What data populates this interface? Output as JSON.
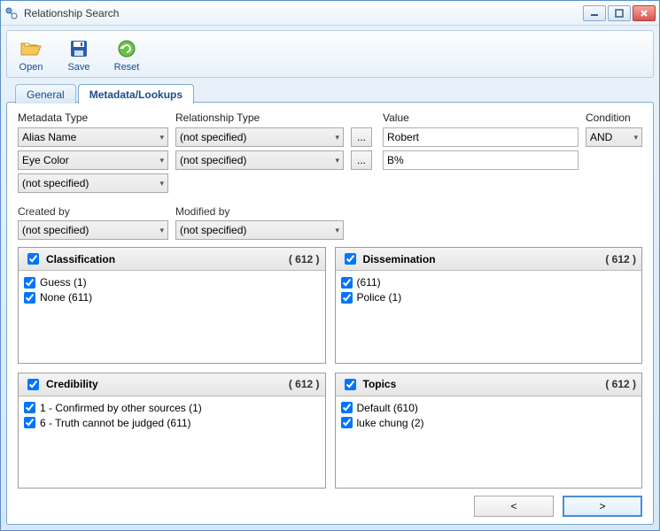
{
  "window": {
    "title": "Relationship Search"
  },
  "toolbar": {
    "open": "Open",
    "save": "Save",
    "reset": "Reset"
  },
  "tabs": {
    "general": "General",
    "metadata": "Metadata/Lookups"
  },
  "headers": {
    "metadata_type": "Metadata Type",
    "relationship_type": "Relationship Type",
    "value": "Value",
    "condition": "Condition",
    "created_by": "Created by",
    "modified_by": "Modified by"
  },
  "filters": {
    "row1": {
      "meta": "Alias Name",
      "rel": "(not specified)",
      "value": "Robert"
    },
    "row2": {
      "meta": "Eye Color",
      "rel": "(not specified)",
      "value": "B%"
    },
    "row3": {
      "meta": "(not specified)"
    },
    "condition": "AND",
    "created_by": "(not specified)",
    "modified_by": "(not specified)",
    "ellipsis": "..."
  },
  "panels": {
    "classification": {
      "title": "Classification",
      "count": "( 612 )",
      "items": [
        "Guess (1)",
        "None (611)"
      ]
    },
    "dissemination": {
      "title": "Dissemination",
      "count": "( 612 )",
      "items": [
        "(611)",
        "Police (1)"
      ]
    },
    "credibility": {
      "title": "Credibility",
      "count": "( 612 )",
      "items": [
        "1 - Confirmed by other sources (1)",
        "6 - Truth cannot be judged (611)"
      ]
    },
    "topics": {
      "title": "Topics",
      "count": "( 612 )",
      "items": [
        "Default (610)",
        "luke chung (2)"
      ]
    }
  },
  "footer": {
    "prev": "<",
    "next": ">"
  }
}
